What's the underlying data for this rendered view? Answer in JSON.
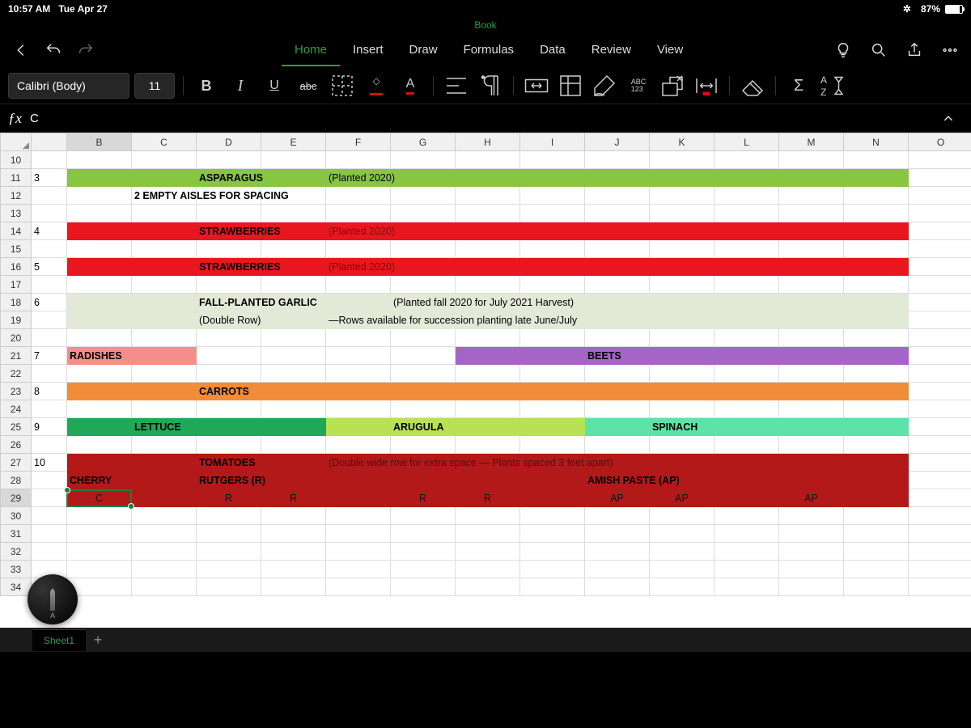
{
  "status": {
    "time": "10:57 AM",
    "date": "Tue Apr 27",
    "battery": "87%"
  },
  "doc_title": "Book",
  "tabs": [
    "Home",
    "Insert",
    "Draw",
    "Formulas",
    "Data",
    "Review",
    "View"
  ],
  "active_tab": "Home",
  "font": {
    "name": "Calibri (Body)",
    "size": "11"
  },
  "ribbon": {
    "bold": "B",
    "italic": "I",
    "underline": "U",
    "strike": "abc",
    "fontcolor": "A",
    "abc123": "ABC\n123",
    "sum": "Σ"
  },
  "formula": {
    "fx": "ƒx",
    "value": "C"
  },
  "columns": [
    "",
    "",
    "B",
    "C",
    "D",
    "E",
    "F",
    "G",
    "H",
    "I",
    "J",
    "K",
    "L",
    "M",
    "N",
    "O"
  ],
  "row_nums": [
    "10",
    "11",
    "12",
    "13",
    "14",
    "15",
    "16",
    "17",
    "18",
    "19",
    "20",
    "21",
    "22",
    "23",
    "24",
    "25",
    "26",
    "27",
    "28",
    "29",
    "30",
    "31",
    "32",
    "33",
    "34"
  ],
  "cells": {
    "r11_A": "3",
    "r11_D": "ASPARAGUS",
    "r11_F": "(Planted 2020)",
    "r12_C": "2 EMPTY AISLES FOR SPACING",
    "r14_A": "4",
    "r14_D": "STRAWBERRIES",
    "r14_F": "(Planted 2020)",
    "r16_A": "5",
    "r16_D": "STRAWBERRIES",
    "r16_F": "(Planted 2020)",
    "r18_A": "6",
    "r18_D": "FALL-PLANTED GARLIC",
    "r18_G": "(Planted fall 2020 for July 2021 Harvest)",
    "r19_D": "(Double Row)",
    "r19_F": "—Rows available for succession planting late June/July",
    "r21_A": "7",
    "r21_B": "RADISHES",
    "r21_J": "BEETS",
    "r23_A": "8",
    "r23_D": "CARROTS",
    "r25_A": "9",
    "r25_C": "LETTUCE",
    "r25_G": "ARUGULA",
    "r25_K": "SPINACH",
    "r27_A": "10",
    "r27_D": "TOMATOES",
    "r27_F": "(Double wide row for extra space — Plants spaced 3 feet apart)",
    "r28_B": "CHERRY",
    "r28_D": "RUTGERS (R)",
    "r28_J": "AMISH PASTE (AP)",
    "r29_B": "C",
    "r29_D": "R",
    "r29_E": "R",
    "r29_G": "R",
    "r29_H": "R",
    "r29_J": "AP",
    "r29_K": "AP",
    "r29_M": "AP"
  },
  "colors": {
    "green": "#88c540",
    "red": "#e8171f",
    "palegreen": "#e2ead7",
    "salmon": "#f58e8a",
    "purple": "#a565c7",
    "orange": "#f08c3a",
    "dgreen": "#1fa858",
    "lime": "#b9e155",
    "mint": "#5de2a8",
    "darkred": "#b31919"
  },
  "sheet": {
    "name": "Sheet1",
    "add": "+"
  },
  "pen_label": "A"
}
